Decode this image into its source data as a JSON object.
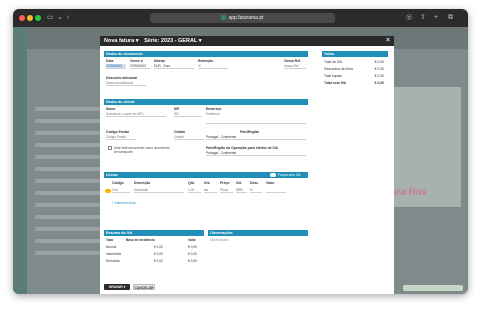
{
  "browser": {
    "url": "app.faturama.pt"
  },
  "modal": {
    "title": "Nova fatura",
    "series_label": "Série: 2023 - GERAL",
    "close": "×",
    "document": {
      "section_title": "Dados do documento",
      "date_label": "Data",
      "date_value": "27/06/2023",
      "due_label": "Vence a",
      "due_value": "27/06/2023",
      "currency_label": "Moeda",
      "currency_value": "EUR - Euro",
      "retention_label": "Retenção",
      "retention_value": "%",
      "ref_label": "Vossa Ref.",
      "ref_placeholder": "Vossa Ref.",
      "discount_label": "Desconto adicional",
      "discount_placeholder": "Desconto adicional"
    },
    "client": {
      "section_title": "Dados do cliente",
      "name_label": "Nome",
      "name_placeholder": "(Introduza o nome ou NIF)",
      "nif_label": "NIF",
      "nif_placeholder": "NIF",
      "address_label": "Endereço",
      "address_placeholder": "Endereço",
      "postal_label": "Código Postal",
      "postal_placeholder": "Código Postal",
      "city_label": "Cidade",
      "city_placeholder": "Cidade",
      "country_label": "País/Região",
      "country_value": "Portugal - Continente",
      "transport_label": "Usar este documento como documento de transporte",
      "op_country_label": "País/Região da Operação para efeitos de IVA",
      "op_country_value": "Portugal - Continente"
    },
    "lines": {
      "section_title": "Linhas",
      "prices_toggle": "Preços sem IVA",
      "columns": [
        "Código",
        "Descrição",
        "Qtd.",
        "Uni.",
        "Preço",
        "IVA",
        "Desc.",
        "Valor"
      ],
      "row": {
        "code": "Cód.",
        "description": "Descrição",
        "qty": "1,00",
        "unit": "un",
        "price": "Preço",
        "vat": "23%",
        "discount": "%",
        "value": ""
      },
      "add_line": "+ Adicionar linha"
    },
    "vat_summary": {
      "section_title": "Resumo do IVA",
      "headers": [
        "Taxa",
        "Base de incidência",
        "Valor"
      ],
      "rows": [
        {
          "rate": "Normal",
          "base": "€ 0,00",
          "value": "€ 0,00"
        },
        {
          "rate": "Intermédia",
          "base": "€ 0,00",
          "value": "€ 0,00"
        },
        {
          "rate": "Reduzida",
          "base": "€ 0,00",
          "value": "€ 0,00"
        }
      ]
    },
    "observations": {
      "section_title": "Observações",
      "placeholder": "Observações"
    },
    "totals": {
      "section_title": "Totais",
      "rows": [
        {
          "label": "Total de IVA",
          "value": "€ 0,00"
        },
        {
          "label": "Descontos de linha",
          "value": "€ 0,00"
        },
        {
          "label": "Total líquido",
          "value": "€ 0,00"
        },
        {
          "label": "Total com IVA",
          "value": "€ 0,00"
        }
      ]
    },
    "footer": {
      "save_label": "GRAVAR",
      "cancel_label": "CANCELAR"
    }
  },
  "background": {
    "watermark": "ara fins"
  },
  "colors": {
    "section_header": "#1f8fb8",
    "modal_header": "#2a2a2a",
    "save_button": "#2a2a2a",
    "overlay": "#7f8a8a"
  }
}
